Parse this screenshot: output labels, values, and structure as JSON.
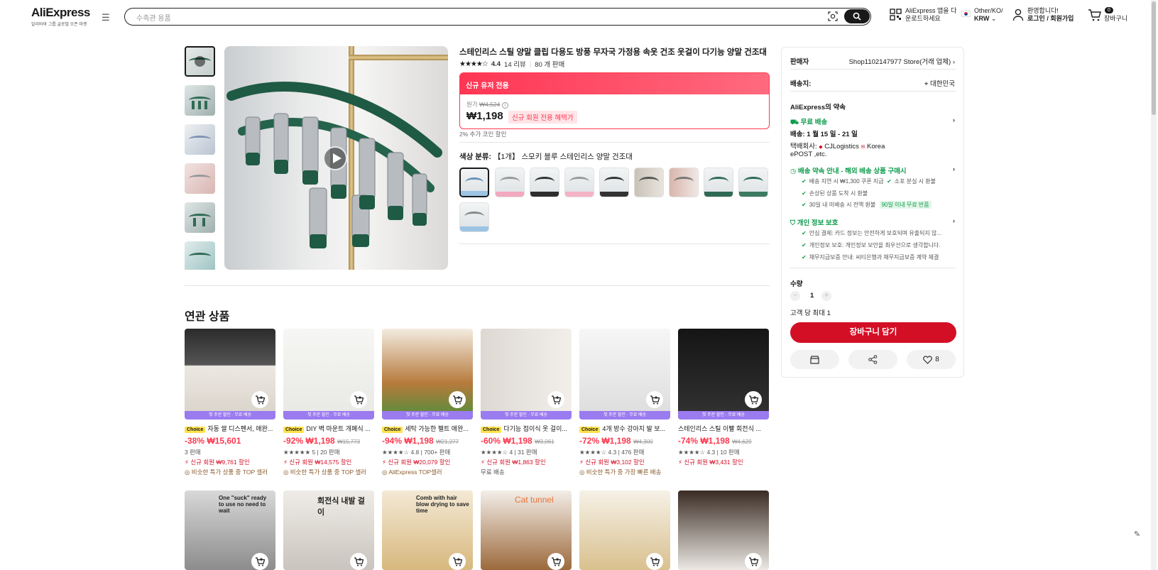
{
  "header": {
    "brand": "AliExpress",
    "brand_tagline": "알리바바 그룹 글로벌 오픈 마켓",
    "search_placeholder": "수족관 용품",
    "app_line1": "AliExpress 앱을 다",
    "app_line2": "운로드하세요",
    "region_line1": "Other/KO/",
    "region_line2": "KRW",
    "account_line1": "환영합니다!",
    "account_line2": "로그인 / 회원가입",
    "cart_count": "0",
    "cart_label": "장바구니"
  },
  "product": {
    "title": "스테인리스 스틸 양말 클립 다용도 방풍 무자국 가정용 속옷 건조 옷걸이 다기능 양말 건조대",
    "rating": "4.4",
    "reviews": "14 리뷰",
    "sold": "80 개 판매",
    "promo_bar": "신규 유저 전용",
    "original_label": "원가",
    "original_price": "₩4,524",
    "price": "₩1,198",
    "promo_badge": "신규 회원 전용 혜택가",
    "coin_note": "2% 추가 코인 할인",
    "color_label": "색상 분류:",
    "color_value": "【1개】 스모키 블루 스테인리스 양말 건조대"
  },
  "panel": {
    "seller_label": "판매자",
    "seller_name": "Shop1102147977 Store(거래 업체)",
    "shipto_label": "배송지:",
    "shipto_value": "대한민국",
    "promise_title": "AliExpress의 약속",
    "free_ship": "무료 배송",
    "delivery": "배송: 1 월 15 일 - 21 일",
    "courier_line1": "택배회사:",
    "courier_cj": "CJLogistics",
    "courier_korea": "Korea",
    "courier_line2": "ePOST ,etc.",
    "guide_title": "배송 약속 안내 - 해외 배송 상품 구매시",
    "guide_items": [
      "배송 지연 시 ₩1,300 쿠폰 지급",
      "소포 분실 시 환불",
      "손상된 상품 도착 시 환불",
      "30일 내 미배송 시 전액 환불"
    ],
    "guide_badge": "90일 이내 무료 반품",
    "privacy_title": "개인 정보 보호",
    "privacy_items": [
      "안심 결제: 카드 정보는 안전하게 보호되며 유출되지 않...",
      "개인정보 보호: 개인정보 보안을 최우선으로 생각합니다.",
      "채무지급보증 안내: 씨티은행과 채무지급보증 계약 체결"
    ],
    "qty_label": "수량",
    "qty_value": "1",
    "qty_max": "고객 당 최대 1",
    "add_cart": "장바구니 담기",
    "wishlist_count": "8"
  },
  "related": {
    "title": "연관 상품",
    "band": "첫 주문 할인 · 무료 배송",
    "cards": [
      {
        "choice": "Choice",
        "name": "자동 쌀 디스펜서, 애완...",
        "discount": "-38%",
        "price": "₩15,601",
        "orig": "",
        "meta": "3 판매",
        "deal": "신규 회원 ₩9,761 할인",
        "extra": "비슷한 특가 상품 중 TOP 셀러"
      },
      {
        "choice": "Choice",
        "name": "DIY 벽 마운트 개폐식 ...",
        "discount": "-92%",
        "price": "₩1,198",
        "orig": "₩15,773",
        "meta": "★★★★★ 5 | 20 판매",
        "deal": "신규 회원 ₩14,575 할인",
        "extra": "비슷한 특가 상품 중 TOP 셀러"
      },
      {
        "choice": "Choice",
        "name": "세탁 가능한 펠트 애완...",
        "discount": "-94%",
        "price": "₩1,198",
        "orig": "₩21,277",
        "meta": "★★★★☆ 4.8 | 700+ 판매",
        "deal": "신규 회원 ₩20,079 할인",
        "extra": "AliExpress TOP셀러"
      },
      {
        "choice": "Choice",
        "name": "다기능 접이식 옷 걸이...",
        "discount": "-60%",
        "price": "₩1,198",
        "orig": "₩3,061",
        "meta": "★★★★☆ 4 | 31 판매",
        "deal": "신규 회원 ₩1,863 할인",
        "extra": "무료 배송"
      },
      {
        "choice": "Choice",
        "name": "4개 방수 강아지 발 보...",
        "discount": "-72%",
        "price": "₩1,198",
        "orig": "₩4,300",
        "meta": "★★★★☆ 4.3 | 476 판매",
        "deal": "신규 회원 ₩3,102 할인",
        "extra": "비슷한 특가 중 가장 빠른 배송"
      },
      {
        "choice": "",
        "name": "스테인리스 스틸 이빨 회전식 ...",
        "discount": "-74%",
        "price": "₩1,198",
        "orig": "₩4,629",
        "meta": "★★★★☆ 4.3 | 10 판매",
        "deal": "신규 회원 ₩3,431 할인",
        "extra": ""
      }
    ],
    "row2_texts": [
      "One \"suck\" ready to use no need to wait",
      "회전식 내발 걸이",
      "Comb with hair blow drying to save time",
      "Cat tunnel",
      "",
      ""
    ]
  },
  "colors": {
    "accent": "#fd384f",
    "cart_button": "#d30f26",
    "green": "#0d9c4b",
    "choice": "#ffe24d",
    "band": "#9b7bf0"
  }
}
